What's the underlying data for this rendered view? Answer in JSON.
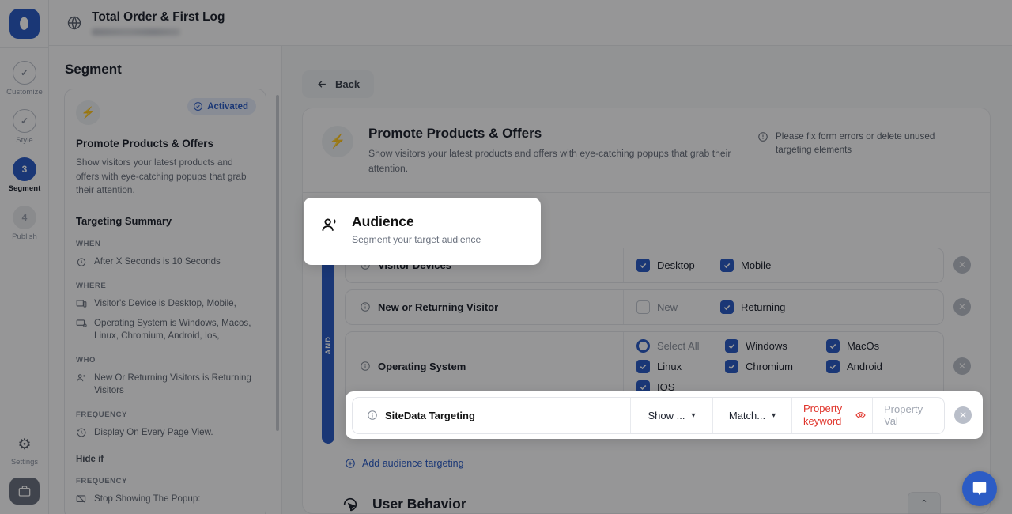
{
  "app": {
    "logo_glyph": "⬮",
    "site_title": "Total Order & First Log"
  },
  "rail": {
    "steps": [
      {
        "badge": "✓",
        "label": "Customize",
        "state": "done"
      },
      {
        "badge": "✓",
        "label": "Style",
        "state": "done"
      },
      {
        "badge": "3",
        "label": "Segment",
        "state": "active"
      },
      {
        "badge": "4",
        "label": "Publish",
        "state": "todo"
      }
    ],
    "settings_label": "Settings",
    "settings_icon": "⚙"
  },
  "left_panel": {
    "heading": "Segment",
    "badge": "Activated",
    "card_title": "Promote Products & Offers",
    "card_desc": "Show visitors your latest products and offers with eye-catching popups that grab their attention.",
    "summary_title": "Targeting Summary",
    "groups": [
      {
        "label": "WHEN",
        "items": [
          {
            "icon": "timer-icon",
            "text": "After X Seconds is 10 Seconds"
          }
        ]
      },
      {
        "label": "WHERE",
        "items": [
          {
            "icon": "device-icon",
            "text": "Visitor's Device is Desktop, Mobile,"
          },
          {
            "icon": "monitor-icon",
            "text": "Operating System is Windows, Macos, Linux, Chromium, Android, Ios,"
          }
        ]
      },
      {
        "label": "WHO",
        "items": [
          {
            "icon": "users-icon",
            "text": "New Or Returning Visitors is Returning Visitors"
          }
        ]
      },
      {
        "label": "FREQUENCY",
        "items": [
          {
            "icon": "history-icon",
            "text": "Display On Every Page View."
          }
        ]
      }
    ],
    "hide_if_label": "Hide if",
    "hide_if_group_label": "FREQUENCY",
    "hide_if_item": "Stop Showing The Popup:"
  },
  "main": {
    "back_label": "Back",
    "promo": {
      "title": "Promote Products & Offers",
      "desc": "Show visitors your latest products and offers with eye-catching popups that grab their attention.",
      "error": "Please fix form errors or delete unused targeting elements"
    },
    "audience": {
      "title": "Audience",
      "desc": "Segment your target audience"
    },
    "and_label": "AND",
    "rules": [
      {
        "name": "Visitor Devices",
        "type": "checkboxes",
        "options": [
          {
            "label": "Desktop",
            "checked": true,
            "width": "opt-w-sm"
          },
          {
            "label": "Mobile",
            "checked": true,
            "width": "opt-w-sm"
          }
        ]
      },
      {
        "name": "New or Returning Visitor",
        "type": "checkboxes",
        "options": [
          {
            "label": "New",
            "checked": false,
            "width": "opt-w-sm"
          },
          {
            "label": "Returning",
            "checked": true,
            "width": "opt-w-sm"
          }
        ]
      },
      {
        "name": "Operating System",
        "type": "checkboxes",
        "options": [
          {
            "label": "Select All",
            "checked": false,
            "radio": true,
            "width": "opt-w-md"
          },
          {
            "label": "Windows",
            "checked": true,
            "width": "opt-w-lg"
          },
          {
            "label": "MacOs",
            "checked": true,
            "width": "opt-w-lg"
          },
          {
            "label": "Linux",
            "checked": true,
            "width": "opt-w-md"
          },
          {
            "label": "Chromium",
            "checked": true,
            "width": "opt-w-lg"
          },
          {
            "label": "Android",
            "checked": true,
            "width": "opt-w-lg"
          },
          {
            "label": "IOS",
            "checked": true,
            "width": "opt-w-lg"
          }
        ]
      }
    ],
    "sitedata": {
      "name": "SiteData Targeting",
      "show_select": "Show ...",
      "match_select": "Match...",
      "keyword_error": "Property keyword",
      "value_placeholder": "Property Val"
    },
    "add_targeting": "Add audience targeting",
    "user_behavior": "User Behavior",
    "scroll_top_glyph": "⌃"
  },
  "colors": {
    "accent": "#2c5cc5",
    "error": "#e0342b",
    "badge_bg": "#e3eaf8",
    "page_bg": "#f4f5f7"
  }
}
